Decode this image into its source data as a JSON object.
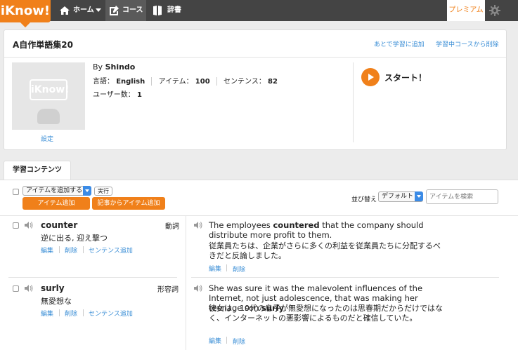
{
  "nav": {
    "logo": "iKnow!",
    "home": "ホーム",
    "course": "コース",
    "dict": "辞書",
    "premium": "プレミアム"
  },
  "course": {
    "title": "A自作単語集20",
    "link_later": "あとで学習に追加",
    "link_remove": "学習中コースから削除",
    "thumb_logo": "iKnow!",
    "settings": "設定",
    "by_prefix": "By",
    "author": "Shindo",
    "lang_label": "言語：",
    "lang": "English",
    "items_label": "アイテム：",
    "items": "100",
    "sent_label": "センテンス：",
    "sentences": "82",
    "users_label": "ユーザー数：",
    "users": "1",
    "start": "スタート！"
  },
  "content": {
    "tab": "学習コンテンツ",
    "action_select": "アイテムを追加する",
    "exec": "実行",
    "btn_add_item": "アイテム追加",
    "btn_add_article": "記事からアイテム追加",
    "sort_label": "並び替え",
    "sort_value": "デフォルト",
    "search_placeholder": "アイテムを検索",
    "edit": "編集",
    "delete": "削除",
    "add_sentence": "センテンス追加"
  },
  "items": [
    {
      "word": "counter",
      "pos": "動詞",
      "meaning": "逆に出る, 迎え撃つ",
      "sent_before": "The employees ",
      "sent_bold": "countered",
      "sent_after": " that the company should distribute more profit to them.",
      "translation": "従業員たちは、企業がさらに多くの利益を従業員たちに分配するべきだと反論しました。"
    },
    {
      "word": "surly",
      "pos": "形容詞",
      "meaning": "無愛想な",
      "sent_before": "She was sure it was the malevolent influences of the Internet, not just adolescence, that was making her teenage son ",
      "sent_bold": "surly",
      "sent_after": ".",
      "translation": "彼女は、10代の息子が無愛想になったのは思春期だからだけではなく、インターネットの悪影響によるものだと確信していた。"
    }
  ]
}
